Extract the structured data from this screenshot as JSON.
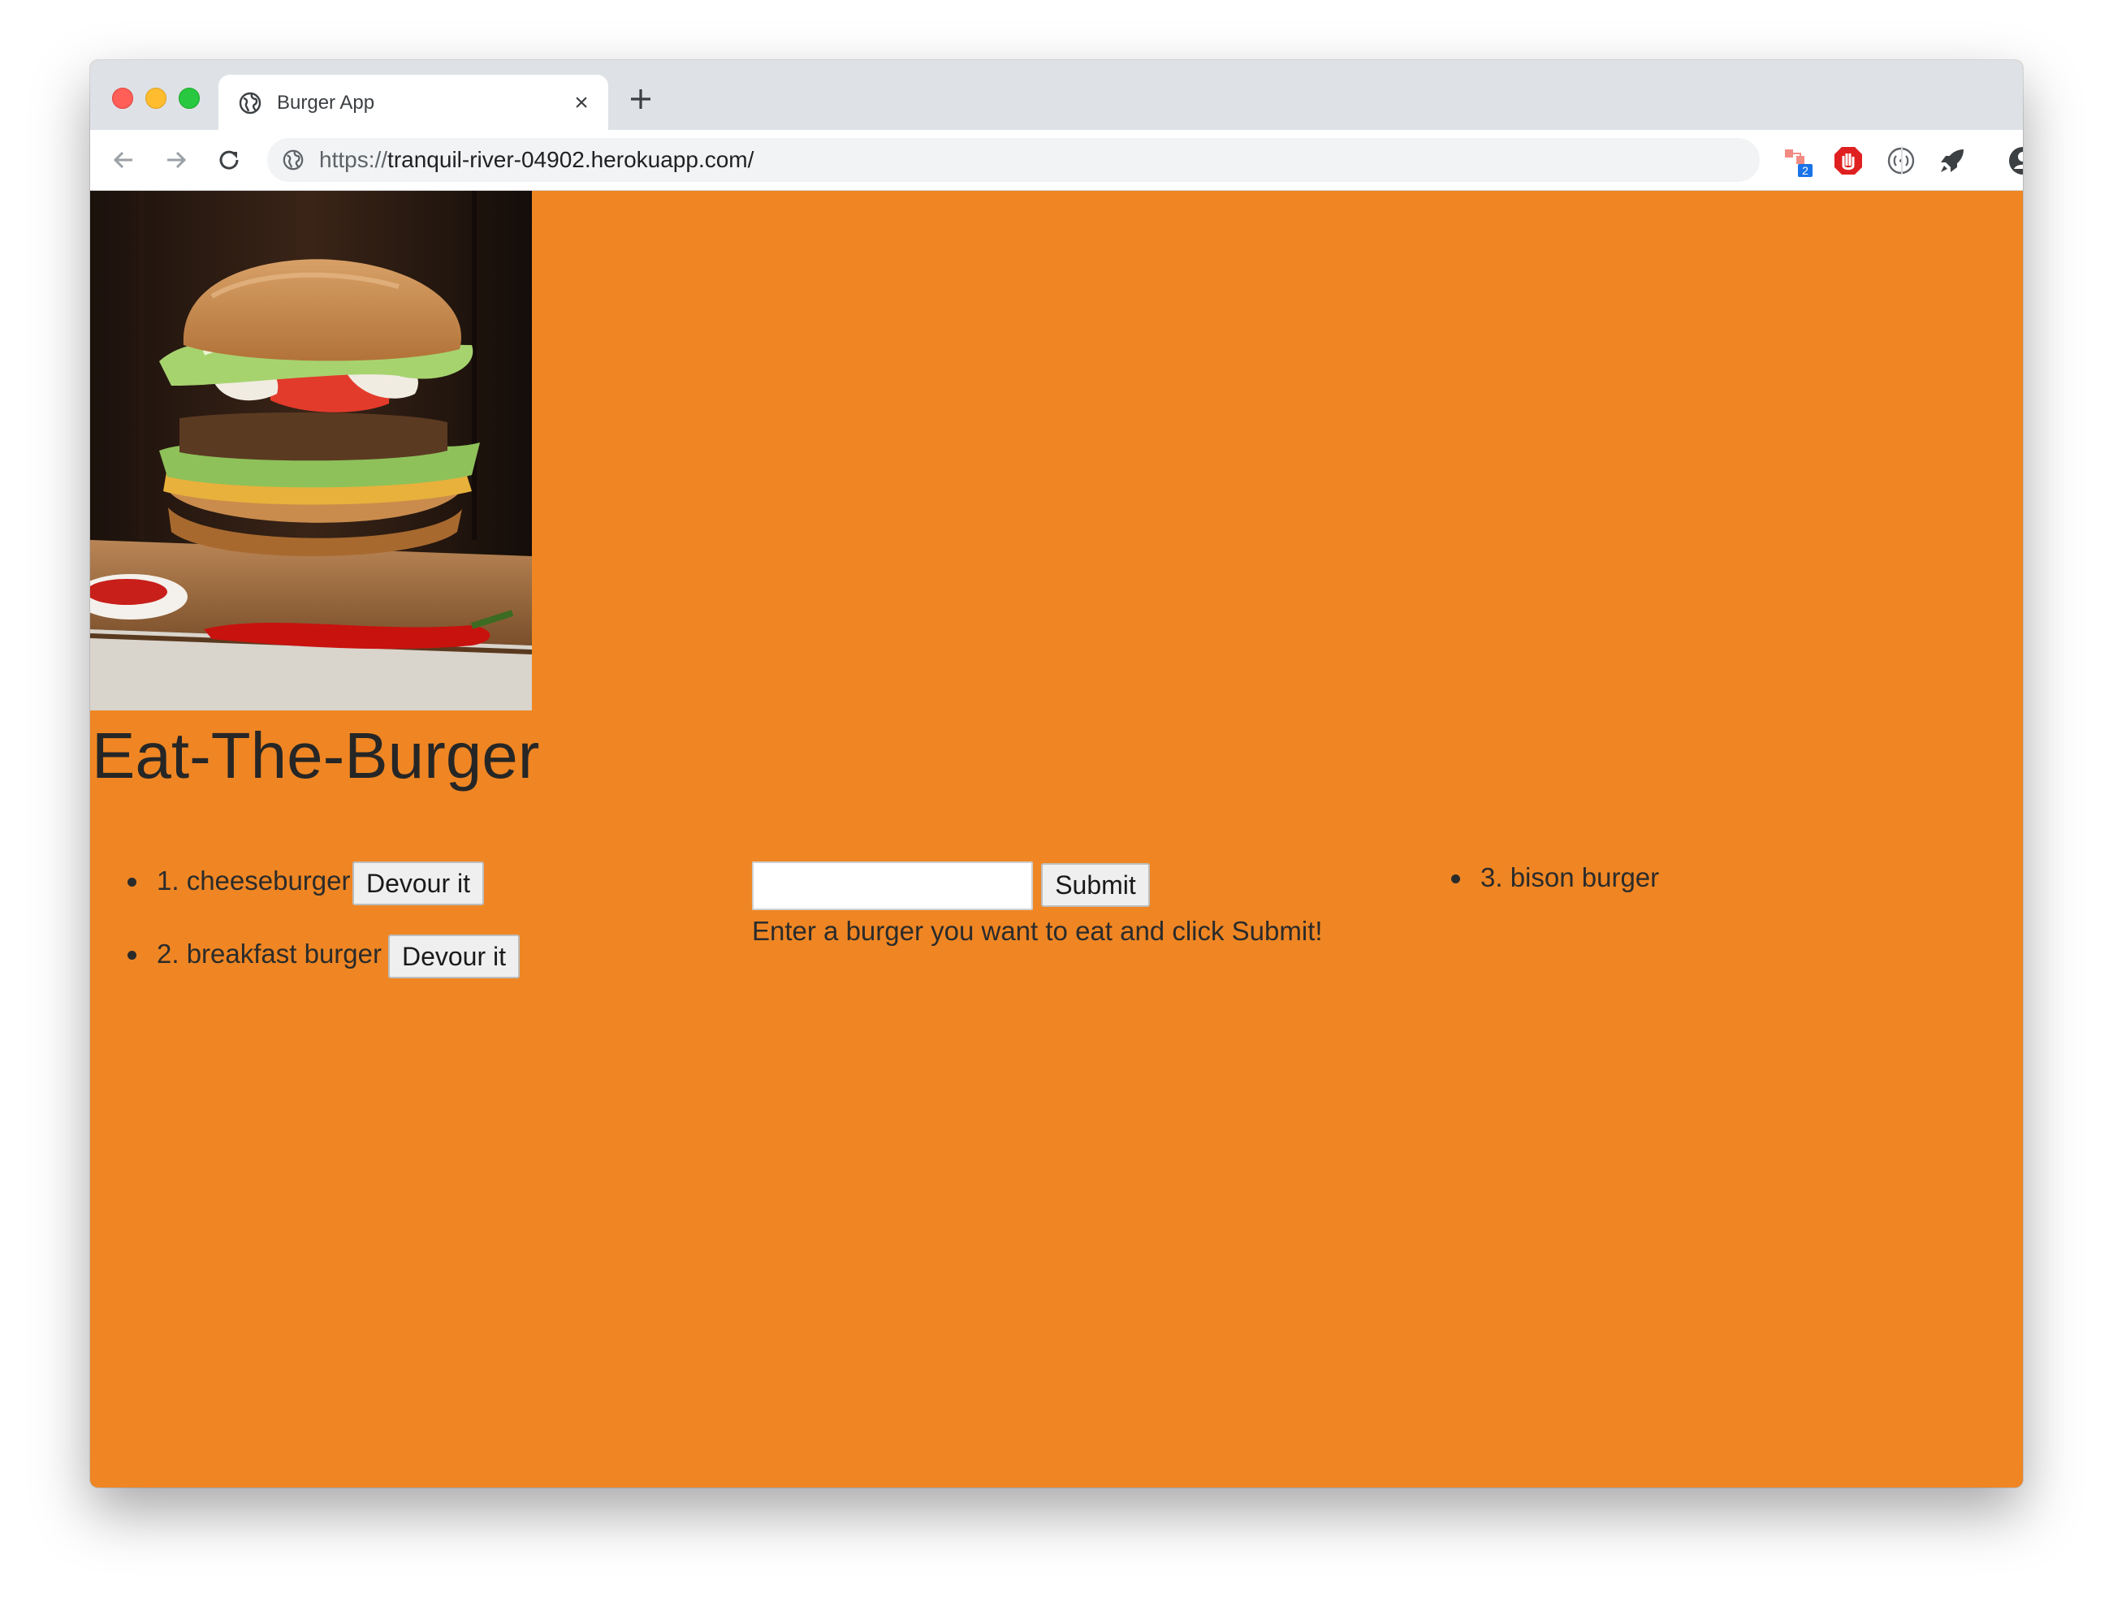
{
  "browser": {
    "tab_title": "Burger App",
    "tab_close": "×",
    "url_scheme": "https://",
    "url_host": "tranquil-river-04902.herokuapp.com/",
    "extension_badge": "2"
  },
  "page": {
    "title": "Eat-The-Burger",
    "hero_image": "burger-photo",
    "background_color": "#ef8623",
    "uneaten_burgers": [
      {
        "label": "1. cheeseburger",
        "button": "Devour it"
      },
      {
        "label": "2. breakfast burger",
        "button": "Devour it"
      }
    ],
    "form": {
      "input_value": "",
      "submit_label": "Submit",
      "helper_text": "Enter a burger you want to eat and click Submit!"
    },
    "devoured_burgers": [
      {
        "label": "3. bison burger"
      }
    ]
  }
}
